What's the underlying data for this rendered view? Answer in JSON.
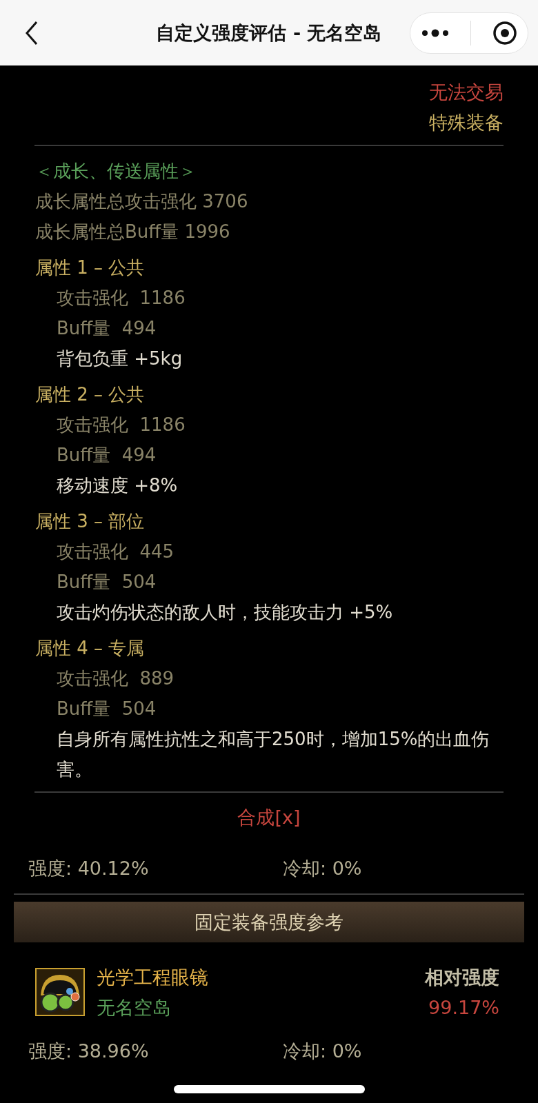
{
  "header": {
    "title": "自定义强度评估 - 无名空岛"
  },
  "tags": [
    {
      "text": "无法交易",
      "kind": "warning"
    },
    {
      "text": "特殊装备",
      "kind": "rarity"
    }
  ],
  "growth": {
    "title": "＜成长、传送属性＞",
    "totals": [
      "成长属性总攻击强化 3706",
      "成长属性总Buff量 1996"
    ],
    "attributes": [
      {
        "title": "属性 1 – 公共",
        "stats": [
          {
            "label": "攻击强化",
            "value": "1186"
          },
          {
            "label": "Buff量",
            "value": "494"
          }
        ],
        "effect": "背包负重 +5kg"
      },
      {
        "title": "属性 2 – 公共",
        "stats": [
          {
            "label": "攻击强化",
            "value": "1186"
          },
          {
            "label": "Buff量",
            "value": "494"
          }
        ],
        "effect": "移动速度 +8%"
      },
      {
        "title": "属性 3 – 部位",
        "stats": [
          {
            "label": "攻击强化",
            "value": "445"
          },
          {
            "label": "Buff量",
            "value": "504"
          }
        ],
        "effect": "攻击灼伤状态的敌人时，技能攻击力 +5%"
      },
      {
        "title": "属性 4 – 专属",
        "stats": [
          {
            "label": "攻击强化",
            "value": "889"
          },
          {
            "label": "Buff量",
            "value": "504"
          }
        ],
        "effect": "自身所有属性抗性之和高于250时，增加15%的出血伤害。"
      }
    ]
  },
  "synthesis": "合成[x]",
  "summary": {
    "strength": "强度: 40.12%",
    "cooldown": "冷却: 0%"
  },
  "reference": {
    "title": "固定装备强度参考",
    "items": [
      {
        "name": "光学工程眼镜",
        "source": "无名空岛",
        "relative_label": "相对强度",
        "relative_value": "99.17%",
        "strength": "强度: 38.96%",
        "cooldown": "冷却: 0%"
      }
    ]
  }
}
